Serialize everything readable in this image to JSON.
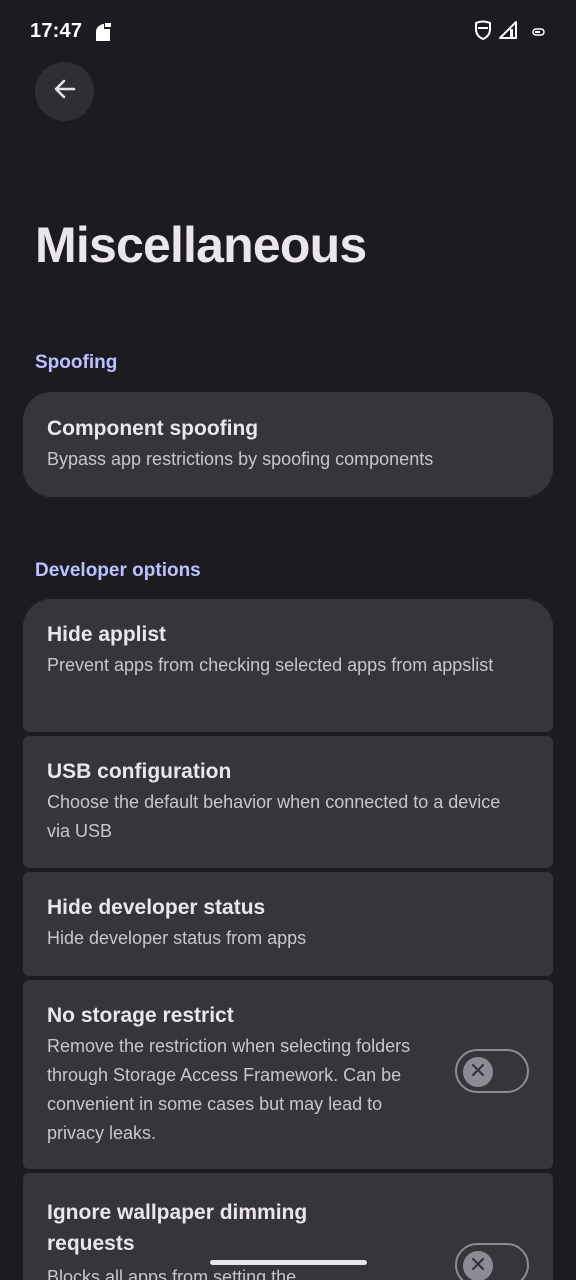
{
  "status_bar": {
    "time": "17:47",
    "icons": [
      "notification-icon",
      "shield-icon",
      "signal-icon",
      "battery-icon"
    ]
  },
  "header": {
    "back_icon": "arrow-left-icon",
    "title": "Miscellaneous"
  },
  "sections": [
    {
      "header": "Spoofing",
      "items": [
        {
          "title": "Component spoofing",
          "description": "Bypass app restrictions by spoofing components"
        }
      ]
    },
    {
      "header": "Developer options",
      "items": [
        {
          "title": "Hide applist",
          "description": "Prevent apps from checking selected apps from appslist"
        },
        {
          "title": "USB configuration",
          "description": "Choose the default behavior when connected to a device via USB"
        },
        {
          "title": "Hide developer status",
          "description": "Hide developer status from apps"
        },
        {
          "title": "No storage restrict",
          "description": "Remove the restriction when selecting folders through Storage Access Framework. Can be convenient in some cases but may lead to privacy leaks.",
          "toggle": "off"
        },
        {
          "title": "Ignore wallpaper dimming requests",
          "description": "Blocks all apps from setting the",
          "toggle": "off"
        }
      ]
    }
  ],
  "colors": {
    "background": "#1c1b21",
    "card": "#36353b",
    "accent": "#bcc2ff",
    "text_primary": "#ebe6ee",
    "text_secondary": "#c9c5cf"
  }
}
